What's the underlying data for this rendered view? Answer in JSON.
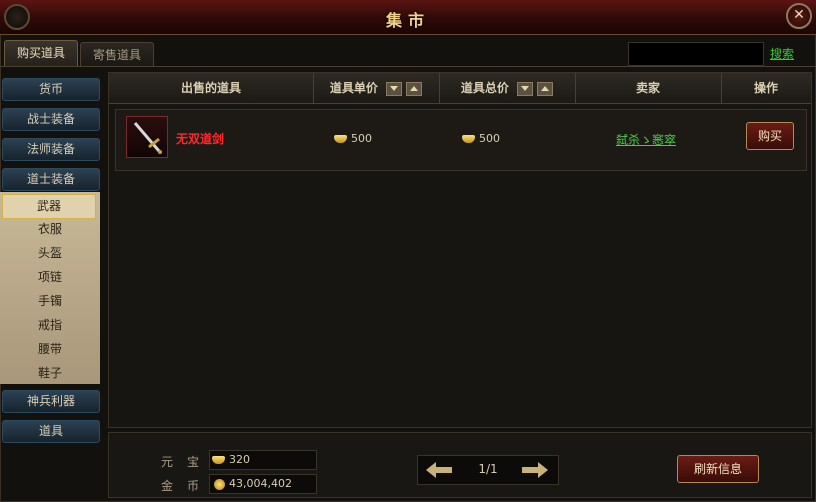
{
  "window": {
    "title": "集市"
  },
  "tabs": {
    "buy": "购买道具",
    "consign": "寄售道具"
  },
  "search": {
    "value": "",
    "link_label": "搜索"
  },
  "sidebar": {
    "categories": [
      "货币",
      "战士装备",
      "法师装备",
      "道士装备"
    ],
    "subitems": [
      "武器",
      "衣服",
      "头盔",
      "项链",
      "手镯",
      "戒指",
      "腰带",
      "鞋子"
    ],
    "active_subitem": "武器",
    "bottom_categories": [
      "神兵利器",
      "道具"
    ]
  },
  "table": {
    "headers": {
      "item": "出售的道具",
      "unit_price": "道具单价",
      "total_price": "道具总价",
      "seller": "卖家",
      "action": "操作"
    },
    "rows": [
      {
        "name": "无双道剑",
        "unit_price": "500",
        "total_price": "500",
        "seller": "弑杀ゝ窸窣",
        "action": "购买"
      }
    ]
  },
  "footer": {
    "yuanbao_label": "元宝",
    "yuanbao_value": "320",
    "gold_label": "金币",
    "gold_value": "43,004,402",
    "page": "1/1",
    "refresh_label": "刷新信息"
  },
  "colors": {
    "accent_red": "#ff2a2a",
    "link_green": "#4fc64f",
    "gold": "#f2d28a"
  },
  "icons": [
    "close-icon",
    "sort-down-icon",
    "sort-up-icon",
    "ingot-icon",
    "coin-icon",
    "arrow-left-icon",
    "arrow-right-icon",
    "sword-icon"
  ]
}
